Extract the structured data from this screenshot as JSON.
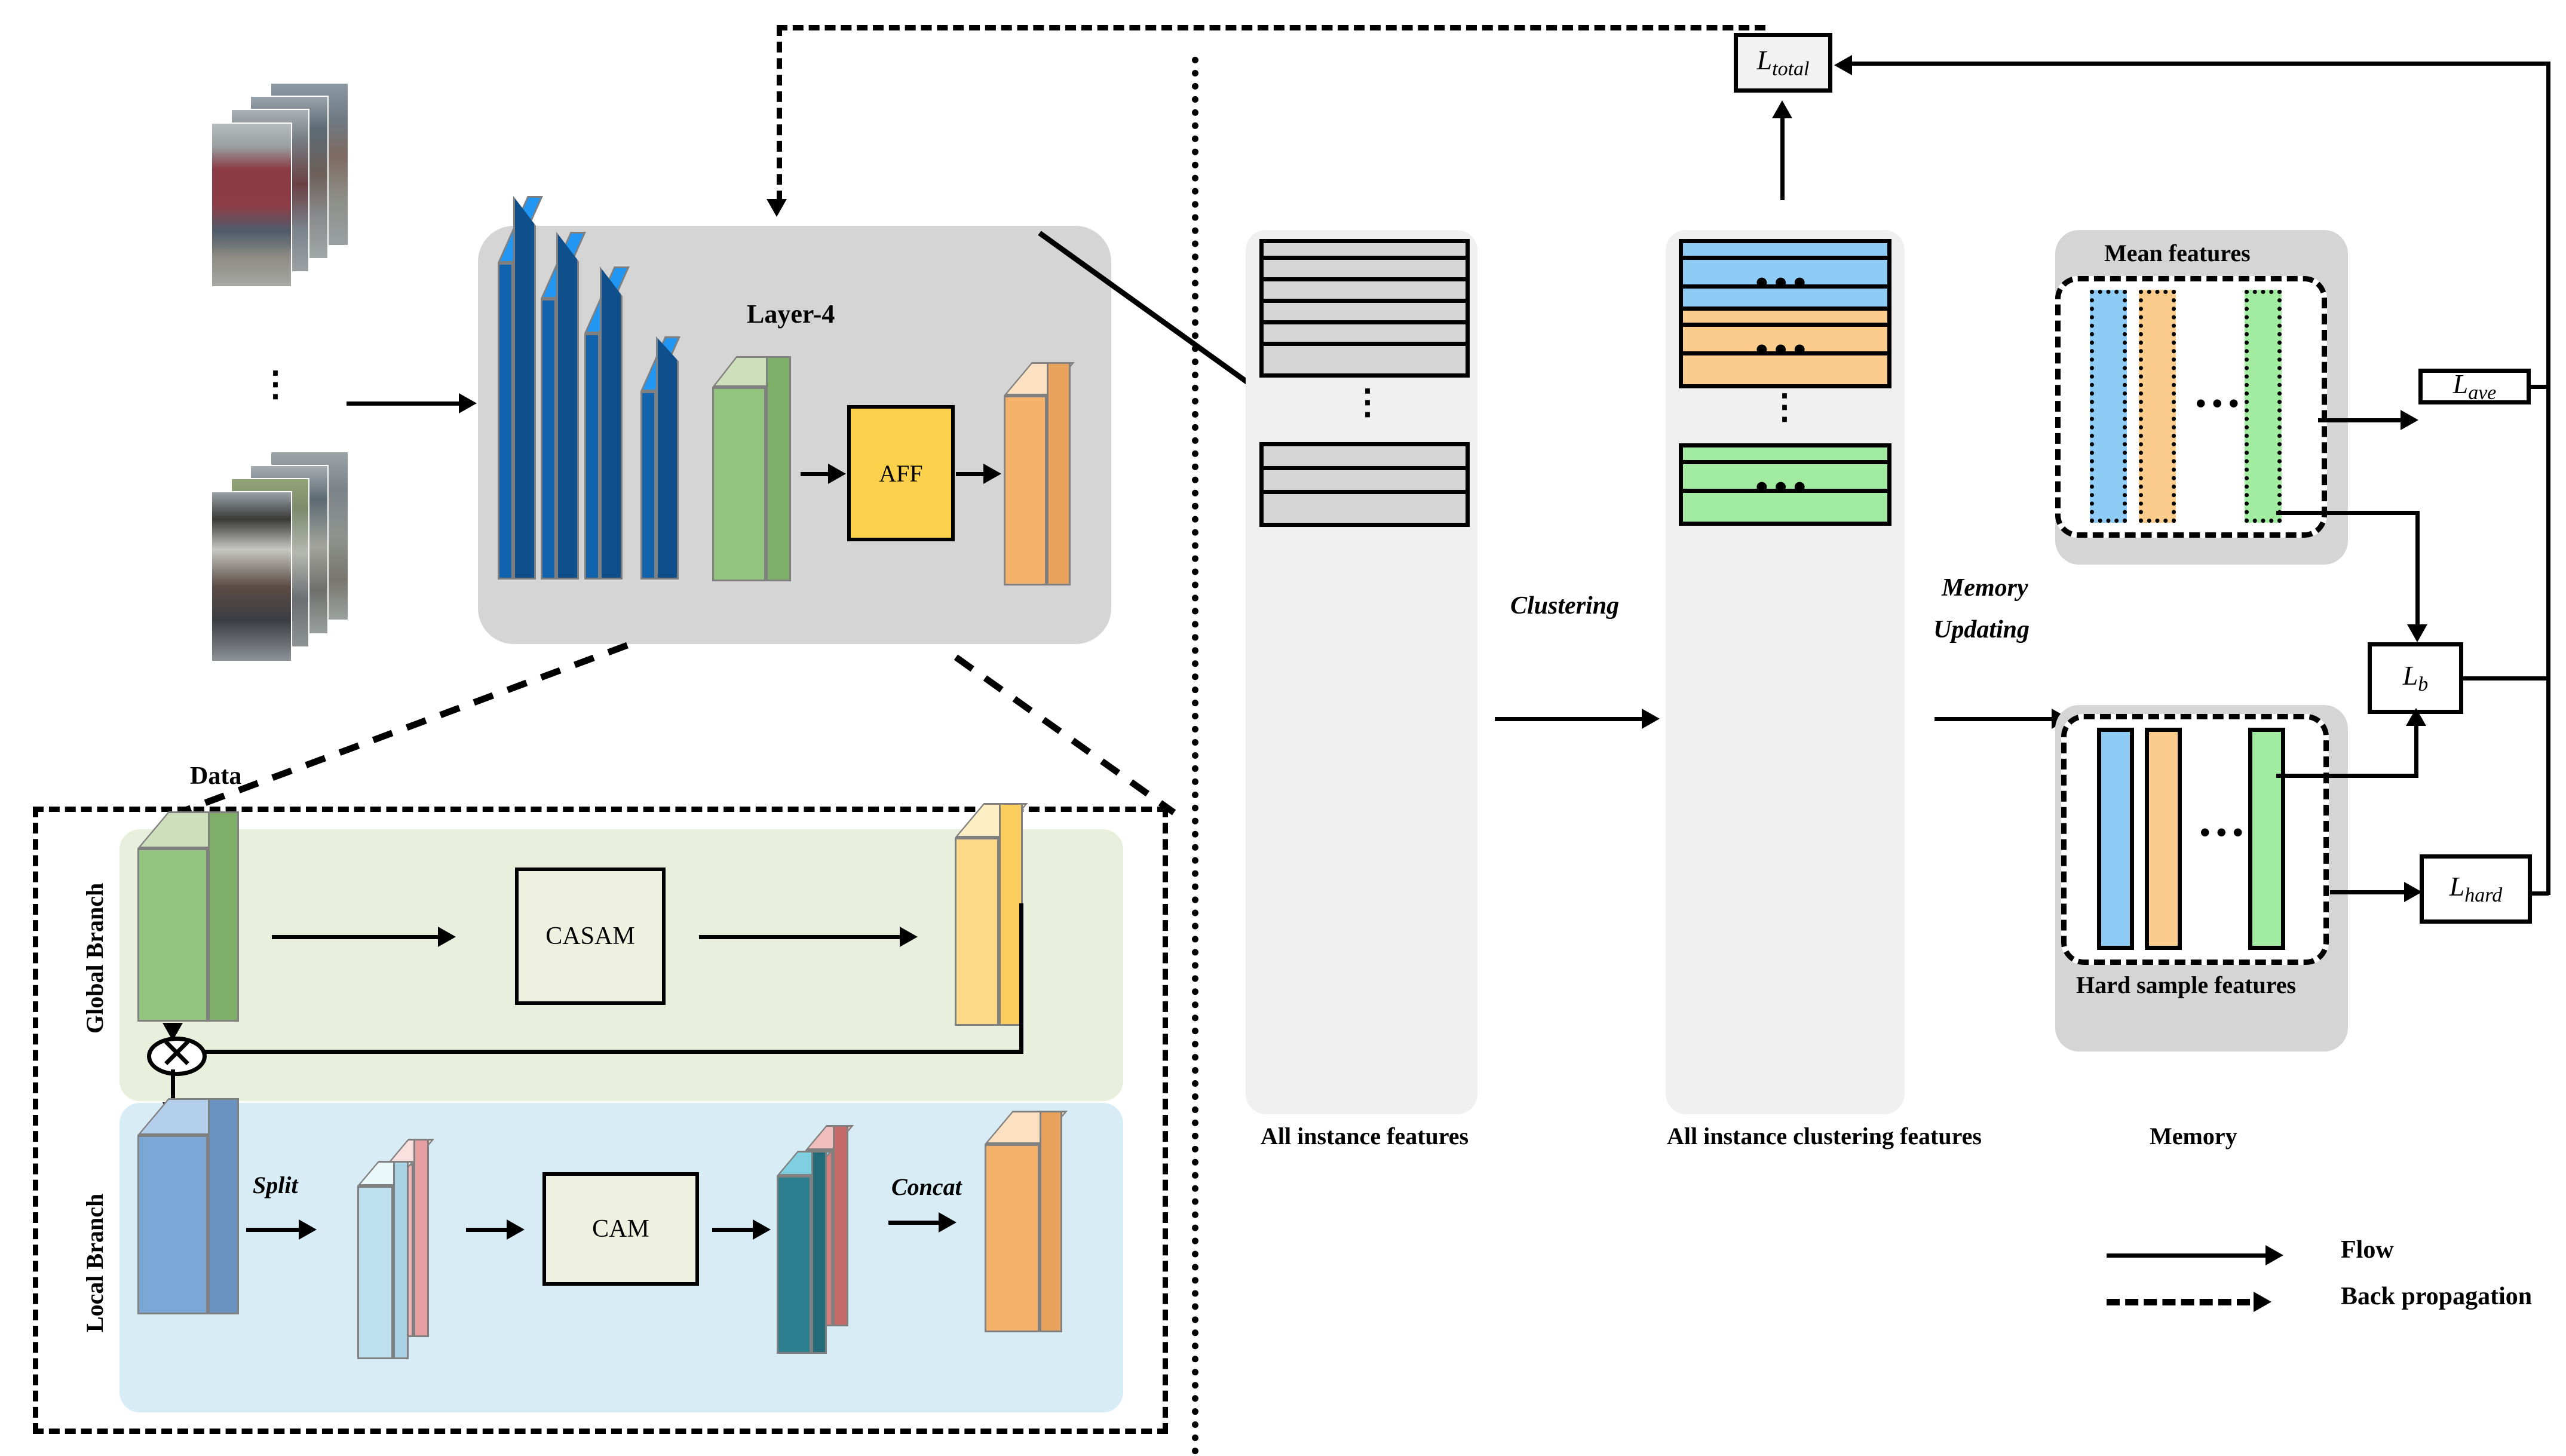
{
  "figure": {
    "title": "Unsupervised person re-identification framework with AFF, clustering and memory",
    "divider": "vertical-dotted-divider"
  },
  "left_panel": {
    "data_label": "Data",
    "backbone_box_label": "Layer-4",
    "aff_label": "AFF",
    "person_stacks": [
      {
        "name": "person-stack-top",
        "count": 4
      },
      {
        "name": "person-stack-bottom",
        "count": 4
      }
    ],
    "stack_ellipsis": "⋮",
    "blue_block_count": 4
  },
  "detail_panel": {
    "global_branch_label": "Global Branch",
    "local_branch_label": "Local Branch",
    "casam_label": "CASAM",
    "cam_label": "CAM",
    "split_label": "Split",
    "concat_label": "Concat",
    "multiply_symbol": "⊗"
  },
  "right_panel": {
    "loss_total": "L",
    "loss_total_sub": "total",
    "clustering_label": "Clustering",
    "memory_updating_label": "Memory Updating",
    "memory_updating_line1": "Memory",
    "memory_updating_line2": "Updating",
    "col_instance_caption": "All instance features",
    "col_cluster_caption": "All instance clustering features",
    "memory_caption": "Memory",
    "mean_features_label": "Mean features",
    "hard_sample_label": "Hard sample features",
    "losses": [
      {
        "name": "L-ave",
        "base": "L",
        "sub": "ave"
      },
      {
        "name": "L-b",
        "base": "L",
        "sub": "b"
      },
      {
        "name": "L-hard",
        "base": "L",
        "sub": "hard"
      }
    ],
    "instance_bars": {
      "top_count": 6,
      "bottom_count": 3,
      "ellipsis": "⋮",
      "color": "#d6d6d6"
    },
    "cluster_bars": {
      "groups": [
        {
          "color": "#8ecbf5",
          "name": "cluster-blue",
          "before_dots": 2,
          "after_dots": 1
        },
        {
          "color": "#fbcc8c",
          "name": "cluster-orange",
          "before_dots": 2,
          "after_dots": 1
        },
        {
          "color": "#a2eca2",
          "name": "cluster-green",
          "before_dots": 2,
          "after_dots": 1
        }
      ],
      "horizontal_ellipsis": "•••",
      "vertical_ellipsis": "⋮"
    },
    "memory_columns": [
      {
        "name": "memory-col-blue",
        "color": "#8ecbf5"
      },
      {
        "name": "memory-col-orange",
        "color": "#fbcc8c"
      },
      {
        "name": "memory-col-green",
        "color": "#a2eca2"
      }
    ],
    "memory_ellipsis": "•••"
  },
  "legend": {
    "flow_label": "Flow",
    "backprop_label": "Back propagation"
  },
  "colors": {
    "panel_grey": "#d5d5d5",
    "soft_grey": "#f0f0f0",
    "blue_feature": "#8ecbf5",
    "orange_feature": "#fbcc8c",
    "green_feature": "#a2eca2",
    "aff_yellow": "#fbd14b",
    "global_branch_bg": "#e8efdc",
    "local_branch_bg": "#d7ecf4",
    "backbone_blue": "#1263ad",
    "backbone_blue_light": "#2196f3",
    "layer4_green": "#93c47d",
    "output_orange": "#f6b26b"
  }
}
